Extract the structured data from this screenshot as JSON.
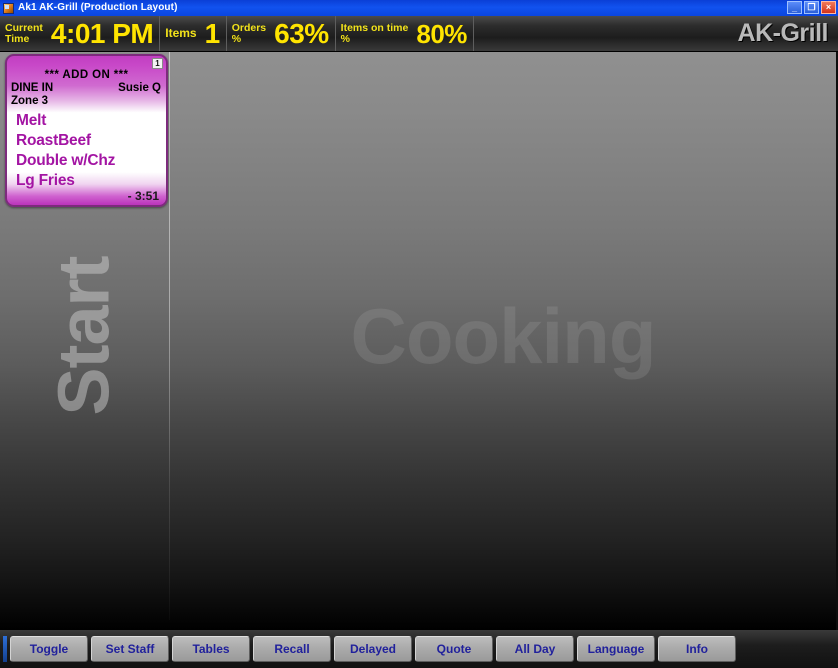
{
  "window": {
    "title": "Ak1 AK-Grill (Production Layout)",
    "icon": "app-icon",
    "controls": {
      "minimize": "_",
      "restore": "❐",
      "close": "×"
    }
  },
  "header": {
    "stats": [
      {
        "label_line1": "Current",
        "label_line2": "Time",
        "value": "4:01 PM"
      },
      {
        "label_line1": "Items",
        "label_line2": "",
        "value": "1"
      },
      {
        "label_line1": "Orders",
        "label_line2": "%",
        "value": "63%"
      },
      {
        "label_line1": "Items on time",
        "label_line2": "%",
        "value": "80%"
      }
    ],
    "brand": "AK-Grill",
    "accent_yellow": "#ffe400",
    "brand_color": "#b9b9b9"
  },
  "workspace": {
    "watermarks": {
      "left_column": "Start",
      "main_column": "Cooking"
    },
    "tickets": [
      {
        "badge": "1",
        "addon_banner": "*** ADD ON ***",
        "order_type": "DINE IN",
        "server": "Susie Q",
        "zone": "Zone 3",
        "items": [
          "Melt",
          "RoastBeef",
          "Double w/Chz",
          "Lg Fries"
        ],
        "timer": "- 3:51",
        "accent_color": "#bb33bb",
        "item_text_color": "#a314a3"
      }
    ]
  },
  "footer": {
    "buttons": [
      "Toggle",
      "Set Staff",
      "Tables",
      "Recall",
      "Delayed",
      "Quote",
      "All Day",
      "Language",
      "Info"
    ],
    "button_text_color": "#21219c"
  }
}
